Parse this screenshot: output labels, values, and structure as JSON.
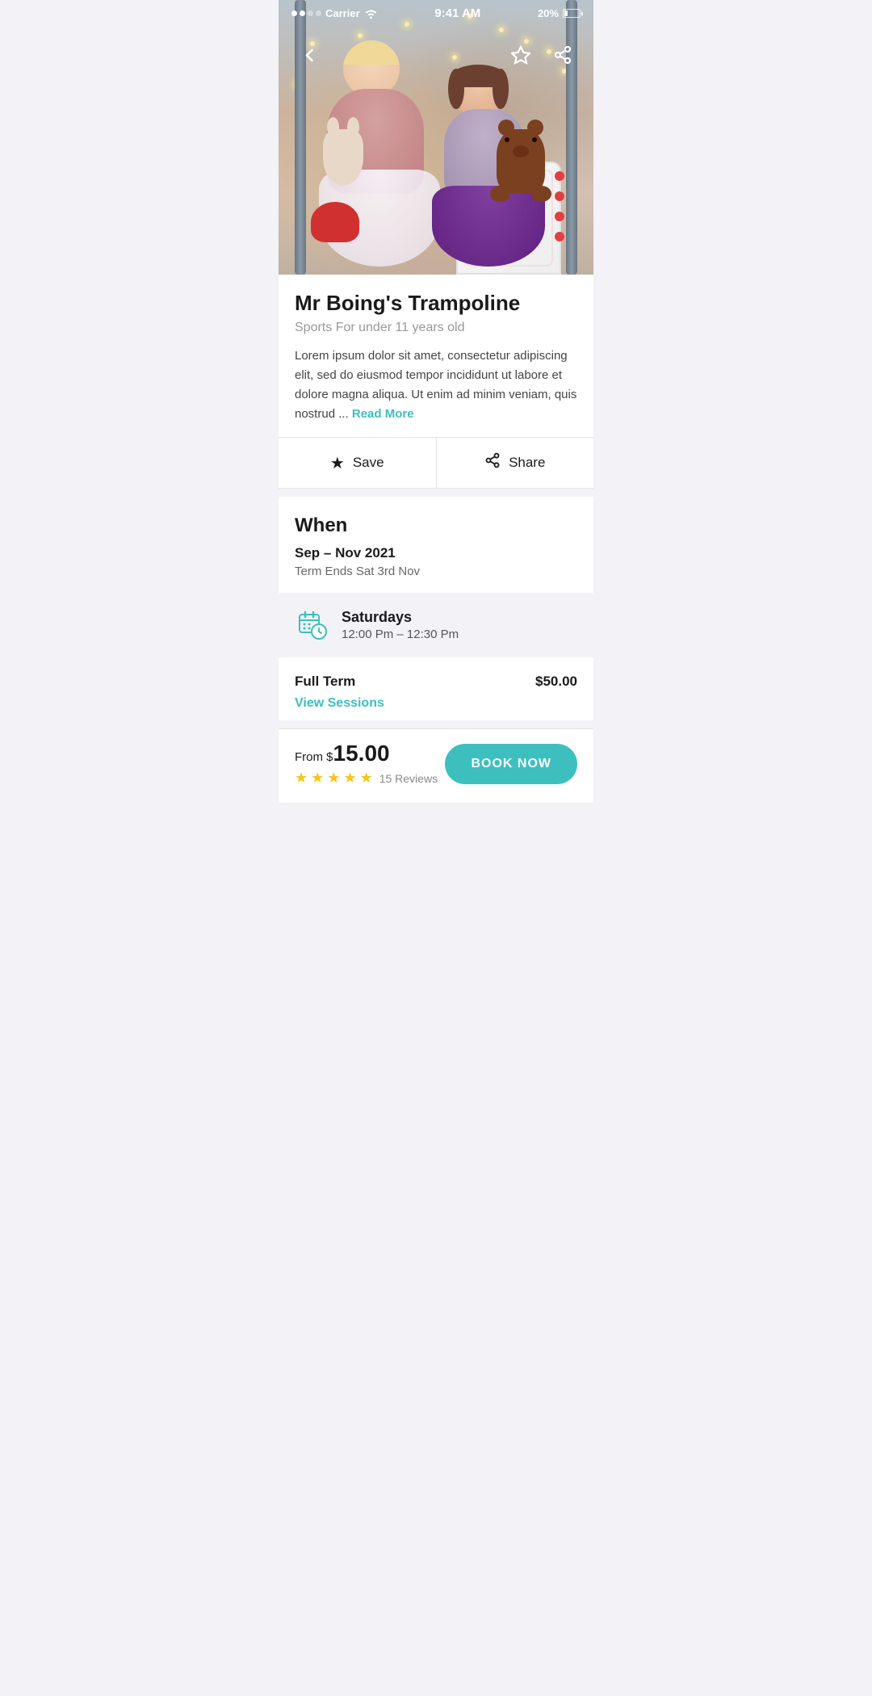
{
  "status_bar": {
    "carrier": "Carrier",
    "time": "9:41 AM",
    "battery_percent": "20%"
  },
  "nav": {
    "back_icon": "chevron-left",
    "bookmark_icon": "star",
    "share_icon": "share"
  },
  "activity": {
    "title": "Mr Boing's Trampoline",
    "subtitle": "Sports For under 11 years old",
    "description": "Lorem ipsum dolor sit amet, consectetur adipiscing elit, sed do eiusmod tempor incididunt ut labore et dolore magna aliqua. Ut enim ad minim veniam, quis nostrud ...",
    "read_more_label": "Read More"
  },
  "actions": {
    "save_label": "Save",
    "share_label": "Share"
  },
  "when": {
    "heading": "When",
    "date_range": "Sep – Nov 2021",
    "term_ends": "Term Ends Sat 3rd Nov",
    "schedule_day": "Saturdays",
    "schedule_time": "12:00 Pm – 12:30 Pm"
  },
  "pricing": {
    "label": "Full Term",
    "amount": "$50.00",
    "view_sessions_label": "View Sessions"
  },
  "bottom_bar": {
    "from_label": "From $",
    "price": "15.00",
    "reviews_count": "15 Reviews",
    "stars": 5,
    "book_label": "BOOK NOW"
  }
}
